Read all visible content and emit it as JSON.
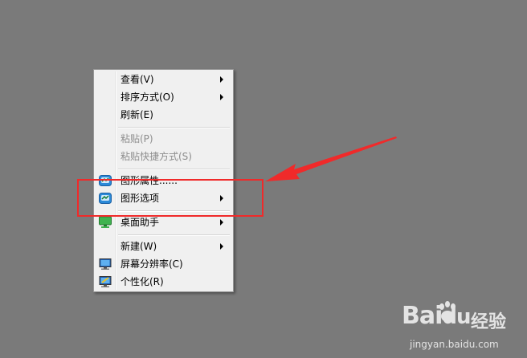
{
  "context_menu": {
    "items": [
      {
        "label": "查看(V)",
        "submenu": true,
        "disabled": false,
        "icon": null
      },
      {
        "label": "排序方式(O)",
        "submenu": true,
        "disabled": false,
        "icon": null
      },
      {
        "label": "刷新(E)",
        "submenu": false,
        "disabled": false,
        "icon": null
      },
      {
        "label": "粘贴(P)",
        "submenu": false,
        "disabled": true,
        "icon": null
      },
      {
        "label": "粘贴快捷方式(S)",
        "submenu": false,
        "disabled": true,
        "icon": null
      },
      {
        "label": "图形属性......",
        "submenu": false,
        "disabled": false,
        "icon": "intel-graphics-icon"
      },
      {
        "label": "图形选项",
        "submenu": true,
        "disabled": false,
        "icon": "intel-graphics-icon"
      },
      {
        "label": "桌面助手",
        "submenu": true,
        "disabled": false,
        "icon": "desktop-assistant-icon"
      },
      {
        "label": "新建(W)",
        "submenu": true,
        "disabled": false,
        "icon": null
      },
      {
        "label": "屏幕分辨率(C)",
        "submenu": false,
        "disabled": false,
        "icon": "monitor-icon"
      },
      {
        "label": "个性化(R)",
        "submenu": false,
        "disabled": false,
        "icon": "personalize-monitor-icon"
      }
    ]
  },
  "annotation": {
    "color": "#f02a2a"
  },
  "watermark": {
    "brand": "Baidu经验",
    "url": "jingyan.baidu.com"
  },
  "colors": {
    "desktop": "#7a7a7a",
    "menu_bg": "#f0f0f0"
  }
}
